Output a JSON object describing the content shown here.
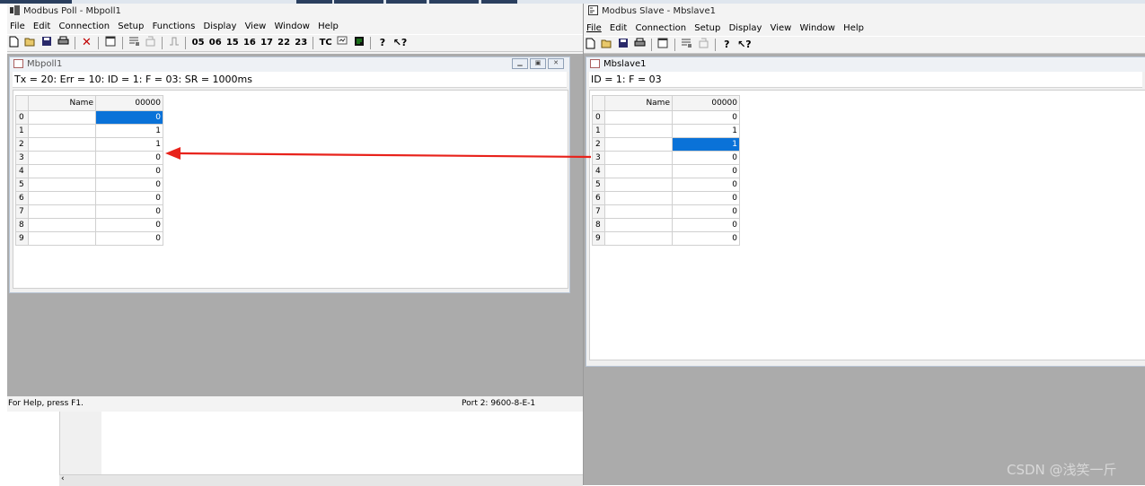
{
  "poll_app": {
    "title": "Modbus Poll - Mbpoll1",
    "menu": [
      "File",
      "Edit",
      "Connection",
      "Setup",
      "Functions",
      "Display",
      "View",
      "Window",
      "Help"
    ],
    "toolbar_codes": [
      "05",
      "06",
      "15",
      "16",
      "17",
      "22",
      "23",
      "TC"
    ],
    "child": {
      "title": "Mbpoll1",
      "status_line": "Tx = 20: Err = 10: ID = 1: F = 03: SR = 1000ms",
      "grid": {
        "name_header": "Name",
        "value_header": "00000",
        "rows": [
          {
            "index": "0",
            "value": "0"
          },
          {
            "index": "1",
            "value": "1"
          },
          {
            "index": "2",
            "value": "1"
          },
          {
            "index": "3",
            "value": "0"
          },
          {
            "index": "4",
            "value": "0"
          },
          {
            "index": "5",
            "value": "0"
          },
          {
            "index": "6",
            "value": "0"
          },
          {
            "index": "7",
            "value": "0"
          },
          {
            "index": "8",
            "value": "0"
          },
          {
            "index": "9",
            "value": "0"
          }
        ]
      }
    },
    "statusbar": {
      "help": "For Help, press F1.",
      "port": "Port 2: 9600-8-E-1"
    }
  },
  "slave_app": {
    "title": "Modbus Slave - Mbslave1",
    "menu": [
      "File",
      "Edit",
      "Connection",
      "Setup",
      "Display",
      "View",
      "Window",
      "Help"
    ],
    "child": {
      "title": "Mbslave1",
      "status_line": "ID = 1: F = 03",
      "grid": {
        "name_header": "Name",
        "value_header": "00000",
        "rows": [
          {
            "index": "0",
            "value": "0"
          },
          {
            "index": "1",
            "value": "1"
          },
          {
            "index": "2",
            "value": "1"
          },
          {
            "index": "3",
            "value": "0"
          },
          {
            "index": "4",
            "value": "0"
          },
          {
            "index": "5",
            "value": "0"
          },
          {
            "index": "6",
            "value": "0"
          },
          {
            "index": "7",
            "value": "0"
          },
          {
            "index": "8",
            "value": "0"
          },
          {
            "index": "9",
            "value": "0"
          }
        ]
      }
    }
  },
  "watermark": "CSDN @浅笑一斤",
  "colors": {
    "selection": "#0a72d8",
    "arrow": "#e8221b",
    "mdi_background": "#ababab"
  }
}
